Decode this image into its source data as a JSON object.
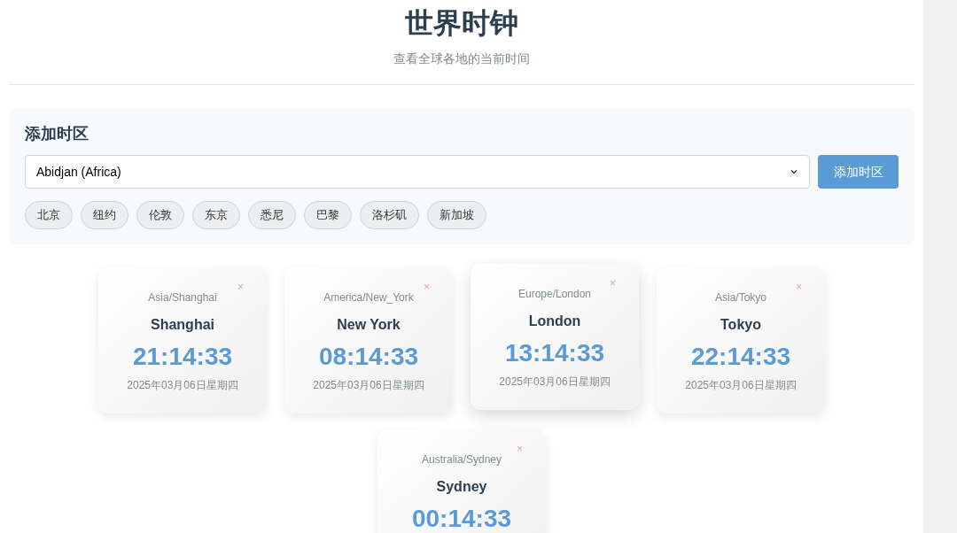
{
  "header": {
    "title": "世界时钟",
    "subtitle": "查看全球各地的当前时间"
  },
  "add_panel": {
    "heading": "添加时区",
    "select_value": "Abidjan (Africa)",
    "button": "添加时区",
    "quick_picks": [
      "北京",
      "纽约",
      "伦敦",
      "东京",
      "悉尼",
      "巴黎",
      "洛杉矶",
      "新加坡"
    ]
  },
  "clocks": [
    {
      "zone": "Asia/Shanghai",
      "city": "Shanghai",
      "time": "21:14:33",
      "date": "2025年03月06日星期四",
      "hovered": false,
      "remove": "×"
    },
    {
      "zone": "America/New_York",
      "city": "New York",
      "time": "08:14:33",
      "date": "2025年03月06日星期四",
      "hovered": false,
      "remove": "×"
    },
    {
      "zone": "Europe/London",
      "city": "London",
      "time": "13:14:33",
      "date": "2025年03月06日星期四",
      "hovered": true,
      "remove": "×"
    },
    {
      "zone": "Asia/Tokyo",
      "city": "Tokyo",
      "time": "22:14:33",
      "date": "2025年03月06日星期四",
      "hovered": false,
      "remove": "×"
    },
    {
      "zone": "Australia/Sydney",
      "city": "Sydney",
      "time": "00:14:33",
      "hovered": false,
      "remove": "×"
    }
  ]
}
